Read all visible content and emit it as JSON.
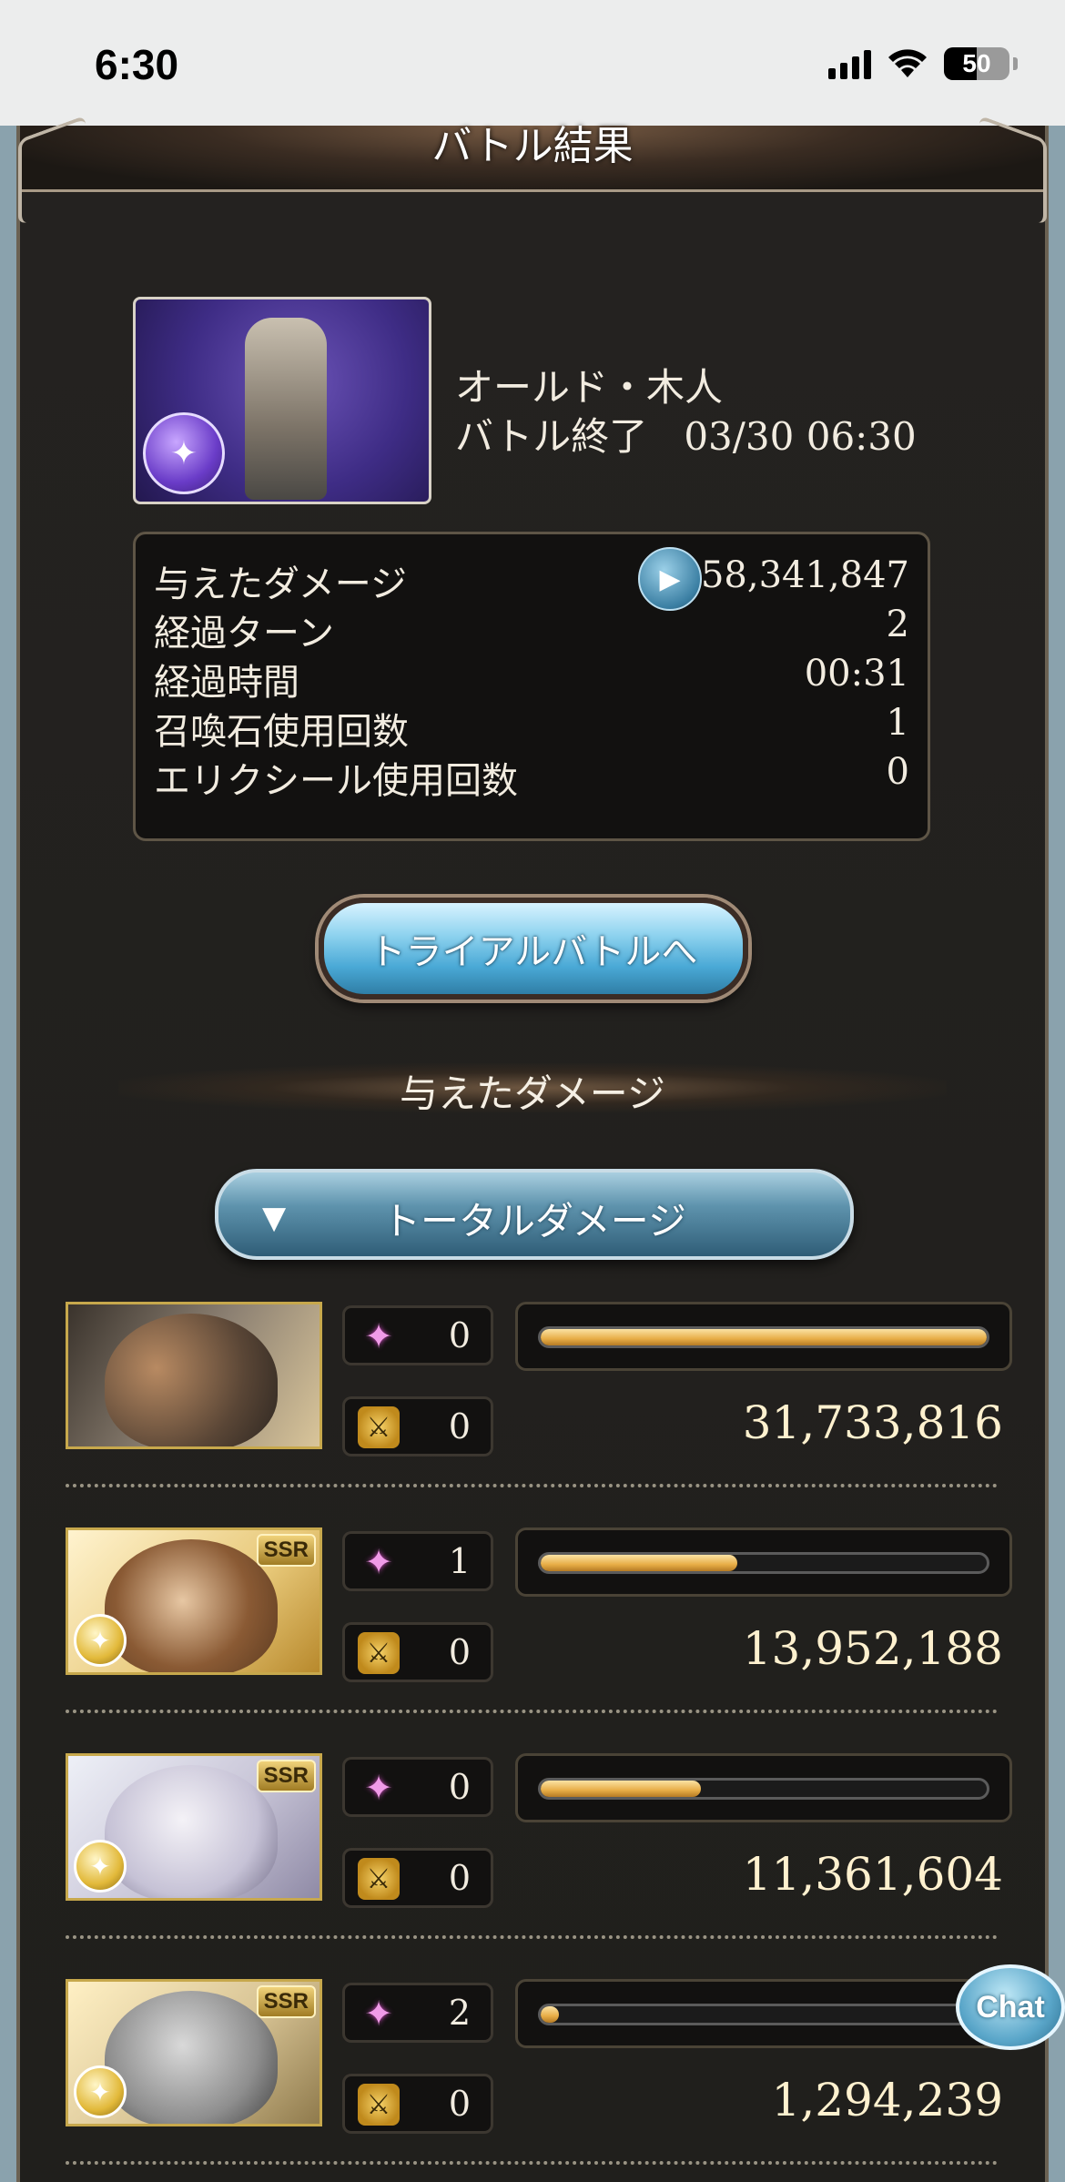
{
  "status_bar": {
    "time": "6:30",
    "battery": "50"
  },
  "header": {
    "title": "バトル結果"
  },
  "boss": {
    "name": "オールド・木人",
    "ended_label": "バトル終了",
    "ended_time": "03/30 06:30"
  },
  "stats": [
    {
      "label": "与えたダメージ",
      "value": "58,341,847"
    },
    {
      "label": "経過ターン",
      "value": "2"
    },
    {
      "label": "経過時間",
      "value": "00:31"
    },
    {
      "label": "召喚石使用回数",
      "value": "1"
    },
    {
      "label": "エリクシール使用回数",
      "value": "0"
    }
  ],
  "trial_button": {
    "label": "トライアルバトルへ"
  },
  "section": {
    "title": "与えたダメージ"
  },
  "damage_filter": {
    "label": "トータルダメージ"
  },
  "characters": [
    {
      "ssr": "",
      "skill_count": "0",
      "ougi_count": "0",
      "damage": "31,733,816",
      "share": 1.0
    },
    {
      "ssr": "SSR",
      "skill_count": "1",
      "ougi_count": "0",
      "damage": "13,952,188",
      "share": 0.44
    },
    {
      "ssr": "SSR",
      "skill_count": "0",
      "ougi_count": "0",
      "damage": "11,361,604",
      "share": 0.36
    },
    {
      "ssr": "SSR",
      "skill_count": "2",
      "ougi_count": "0",
      "damage": "1,294,239",
      "share": 0.04
    }
  ],
  "chat": {
    "label": "Chat"
  }
}
